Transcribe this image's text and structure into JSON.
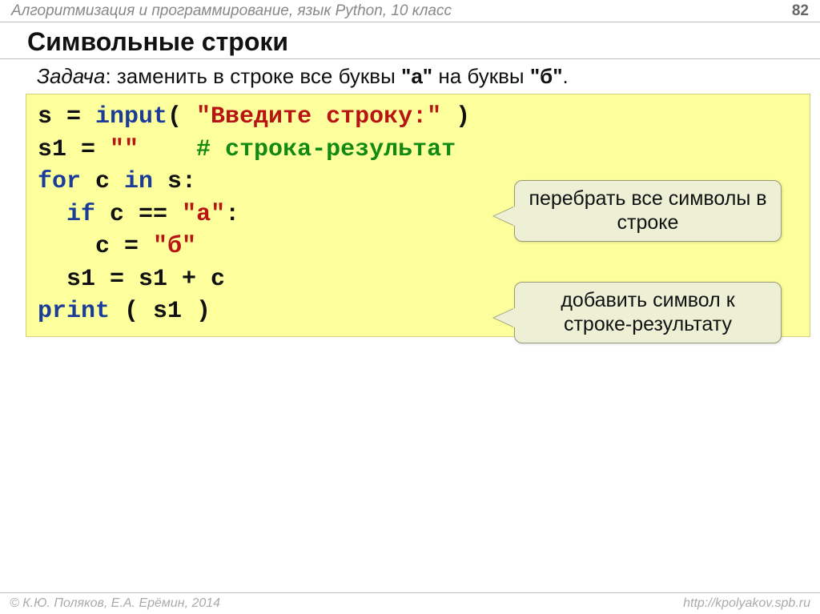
{
  "header": {
    "course": "Алгоритмизация и программирование, язык Python, 10 класс",
    "page": "82"
  },
  "title": "Символьные строки",
  "task": {
    "label": "Задача",
    "text_before": ": заменить в строке все буквы ",
    "a": "\"а\"",
    "mid": " на буквы ",
    "b": "\"б\"",
    "tail": "."
  },
  "code": {
    "l1_s": "s = ",
    "l1_input": "input",
    "l1_open": "( ",
    "l1_str": "\"Введите строку:\"",
    "l1_close": " )",
    "l2_s1": "s1 = ",
    "l2_str": "\"\"",
    "l2_gap": "    ",
    "l2_cmt": "# строка-результат",
    "l3_for": "for",
    "l3_c": " c ",
    "l3_in": "in",
    "l3_tail": " s:",
    "l4_pad": "  ",
    "l4_if": "if",
    "l4_mid": " c == ",
    "l4_str": "\"а\"",
    "l4_tail": ":",
    "l5_pad": "    ",
    "l5_c": "c = ",
    "l5_str": "\"б\"",
    "l6_pad": "  ",
    "l6_txt": "s1 = s1 + c",
    "l7_print": "print",
    "l7_args": " ( s1 )"
  },
  "callout1": "перебрать все символы в строке",
  "callout2": "добавить символ к строке-результату",
  "footer": {
    "left": "© К.Ю. Поляков, Е.А. Ерёмин, 2014",
    "right": "http://kpolyakov.spb.ru"
  }
}
